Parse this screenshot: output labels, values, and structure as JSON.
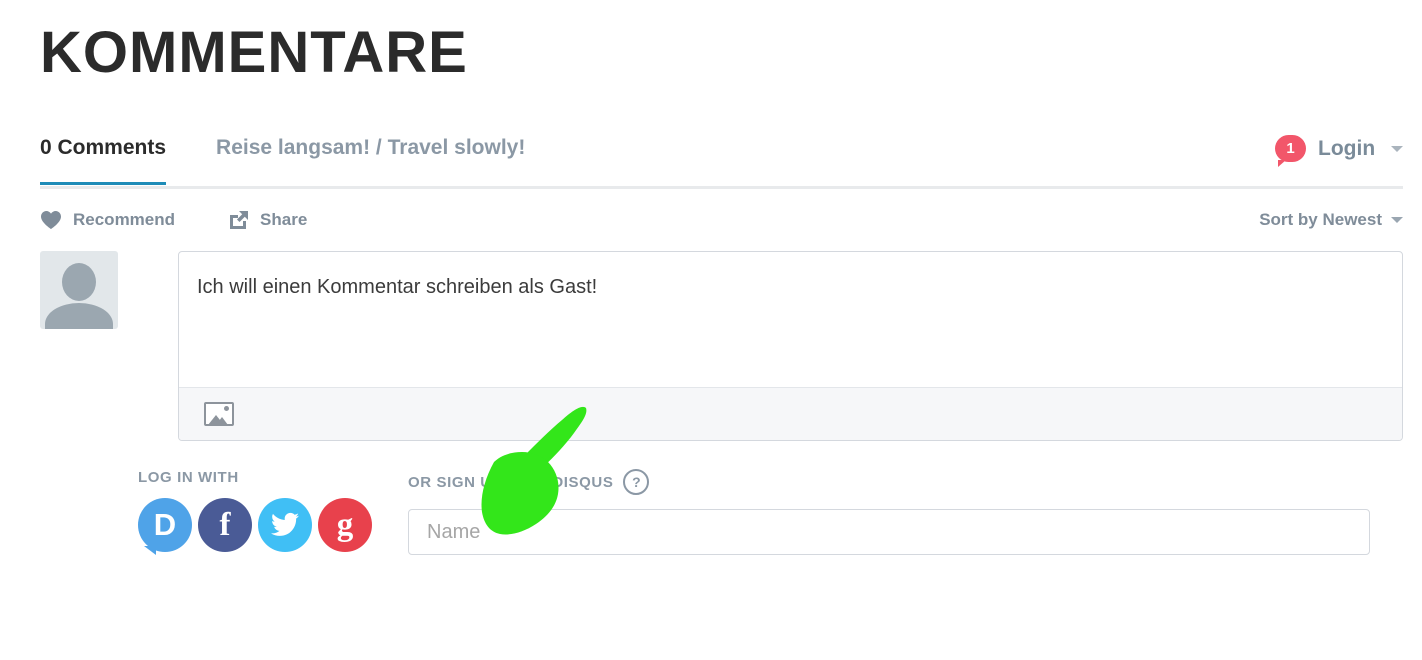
{
  "page": {
    "title": "KOMMENTARE"
  },
  "tabs": {
    "comments_label": "0 Comments",
    "thread_label": "Reise langsam! / Travel slowly!",
    "notification_count": "1",
    "login_label": "Login",
    "caret_icon": "chevron-down-icon"
  },
  "actions": {
    "recommend_label": "Recommend",
    "recommend_icon": "heart-icon",
    "share_label": "Share",
    "share_icon": "share-icon",
    "sort_label": "Sort by Newest",
    "sort_caret_icon": "chevron-down-icon"
  },
  "composer": {
    "avatar_icon": "default-avatar-icon",
    "text": "Ich will einen Kommentar schreiben als Gast!",
    "media_icon": "image-upload-icon"
  },
  "auth": {
    "login_with_heading": "LOG IN WITH",
    "signup_heading": "OR SIGN UP WITH DISQUS",
    "help_glyph": "?",
    "help_icon": "help-circle-icon",
    "providers": [
      {
        "name": "disqus",
        "glyph": "D",
        "icon": "disqus-icon",
        "color": "#4fa3e8"
      },
      {
        "name": "facebook",
        "glyph": "f",
        "icon": "facebook-icon",
        "color": "#4a5b96"
      },
      {
        "name": "twitter",
        "glyph": "",
        "icon": "twitter-icon",
        "color": "#40bff5"
      },
      {
        "name": "google",
        "glyph": "g",
        "icon": "google-icon",
        "color": "#e8414c"
      }
    ],
    "name_placeholder": "Name",
    "name_value": ""
  },
  "annotation": {
    "type": "hand-drawn-arrow",
    "color": "#33e61a",
    "points_to": "name-input"
  },
  "colors": {
    "active_tab_underline": "#1e8cb8",
    "badge": "#f2566a",
    "muted_text": "#8b98a5",
    "title_text": "#2b2b2b",
    "annotation_green": "#33e61a"
  }
}
